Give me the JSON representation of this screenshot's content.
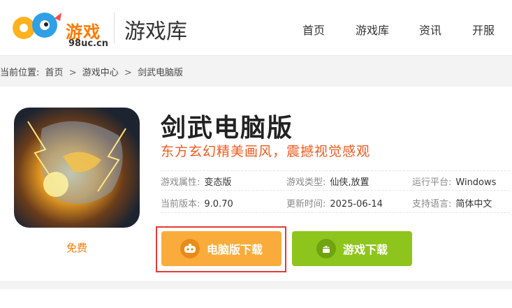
{
  "header": {
    "logo_text": "游戏",
    "logo_domain": "98uc.cn",
    "site_title": "游戏库",
    "nav": [
      "首页",
      "游戏库",
      "资讯",
      "开服"
    ]
  },
  "breadcrumb": {
    "prefix": "当前位置:",
    "items": [
      "首页",
      "游戏中心",
      "剑武电脑版"
    ],
    "separator": ">"
  },
  "game": {
    "title": "剑武电脑版",
    "slogan": "东方玄幻精美画风，震撼视觉感观",
    "price": "免费",
    "attributes": [
      {
        "label": "游戏属性:",
        "value": "变态版"
      },
      {
        "label": "游戏类型:",
        "value": "仙侠,放置"
      },
      {
        "label": "运行平台:",
        "value": "Windows"
      },
      {
        "label": "当前版本:",
        "value": "9.0.70"
      },
      {
        "label": "更新时间:",
        "value": "2025-06-14"
      },
      {
        "label": "支持语言:",
        "value": "简体中文"
      }
    ]
  },
  "buttons": {
    "pc_download": "电脑版下载",
    "game_download": "游戏下载"
  },
  "colors": {
    "brand_orange": "#ff7a00",
    "slogan_orange": "#f05a1e",
    "pc_button": "#f9ac3c",
    "game_button": "#8ec51d",
    "highlight_outline": "#e53935"
  }
}
